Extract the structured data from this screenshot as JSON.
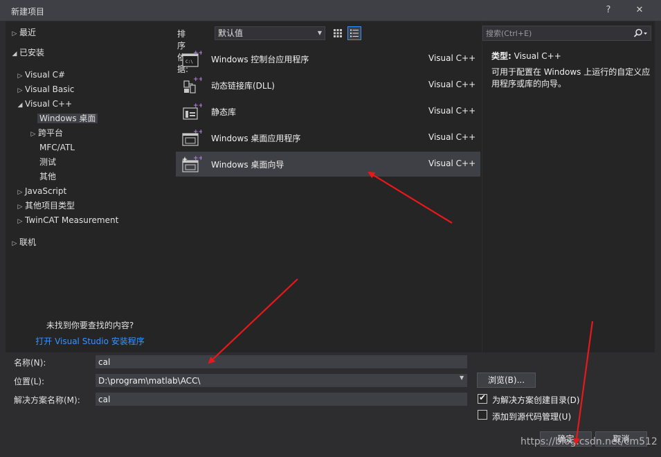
{
  "window": {
    "title": "新建项目",
    "help_glyph": "?",
    "close_glyph": "✕"
  },
  "tree": {
    "items": [
      {
        "label": "最近",
        "tri": "▷"
      },
      {
        "label": "已安装",
        "tri": "◢"
      },
      {
        "label": "Visual C#",
        "tri": "▷"
      },
      {
        "label": "Visual Basic",
        "tri": "▷"
      },
      {
        "label": "Visual C++",
        "tri": "◢"
      },
      {
        "label": "Windows 桌面",
        "tri": ""
      },
      {
        "label": "跨平台",
        "tri": "▷"
      },
      {
        "label": "MFC/ATL",
        "tri": ""
      },
      {
        "label": "测试",
        "tri": ""
      },
      {
        "label": "其他",
        "tri": ""
      },
      {
        "label": "JavaScript",
        "tri": "▷"
      },
      {
        "label": "其他项目类型",
        "tri": "▷"
      },
      {
        "label": "TwinCAT Measurement",
        "tri": "▷"
      },
      {
        "label": "联机",
        "tri": "▷"
      }
    ],
    "not_found_text": "未找到你要查找的内容?",
    "installer_link": "打开 Visual Studio 安装程序"
  },
  "sort": {
    "label": "排序依据:",
    "value": "默认值",
    "arrow": "▼"
  },
  "templates": [
    {
      "name": "Windows 控制台应用程序",
      "lang": "Visual C++",
      "icon_text": "C:\\"
    },
    {
      "name": "动态链接库(DLL)",
      "lang": "Visual C++",
      "icon_text": ""
    },
    {
      "name": "静态库",
      "lang": "Visual C++",
      "icon_text": ""
    },
    {
      "name": "Windows 桌面应用程序",
      "lang": "Visual C++",
      "icon_text": ""
    },
    {
      "name": "Windows 桌面向导",
      "lang": "Visual C++",
      "icon_text": ""
    }
  ],
  "search": {
    "placeholder": "搜索(Ctrl+E)"
  },
  "description": {
    "type_label": "类型:",
    "type_value": "Visual C++",
    "text": "可用于配置在 Windows 上运行的自定义应用程序或库的向导。"
  },
  "form": {
    "name_label": "名称(N):",
    "name_value": "cal",
    "location_label": "位置(L):",
    "location_value": "D:\\program\\matlab\\ACC\\",
    "location_arrow": "▼",
    "solution_label": "解决方案名称(M):",
    "solution_value": "cal",
    "browse_label": "浏览(B)...",
    "create_dir_label": "为解决方案创建目录(D)",
    "create_dir_mark": "✔",
    "add_scc_label": "添加到源代码管理(U)"
  },
  "buttons": {
    "ok_label": "确定",
    "cancel_label": "取消"
  },
  "watermark": "https://blog.csdn.net/cm512",
  "colors": {
    "accent_blue": "#3794ff",
    "arrow_red": "#e8181b",
    "plus_purple": "#b180d7"
  }
}
